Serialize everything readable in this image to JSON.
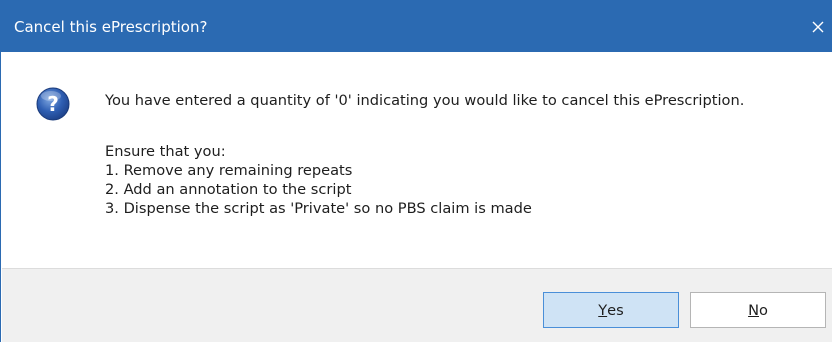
{
  "dialog": {
    "title": "Cancel this ePrescription?",
    "close_glyph": "✕",
    "icon": "question-icon",
    "message": "You have entered a quantity of '0' indicating you would like to cancel this ePrescription.",
    "instructions_heading": "Ensure that you:",
    "instructions": [
      "1. Remove any remaining repeats",
      "2. Add an annotation to the script",
      "3. Dispense the script as 'Private' so no PBS claim is made"
    ],
    "buttons": {
      "yes": {
        "mnemonic": "Y",
        "rest": "es"
      },
      "no": {
        "mnemonic": "N",
        "rest": "o"
      }
    }
  },
  "colors": {
    "title_bar": "#2b6ab2",
    "footer": "#f0f0f0",
    "default_button": "#cfe3f5",
    "default_button_border": "#4a8fd8"
  }
}
